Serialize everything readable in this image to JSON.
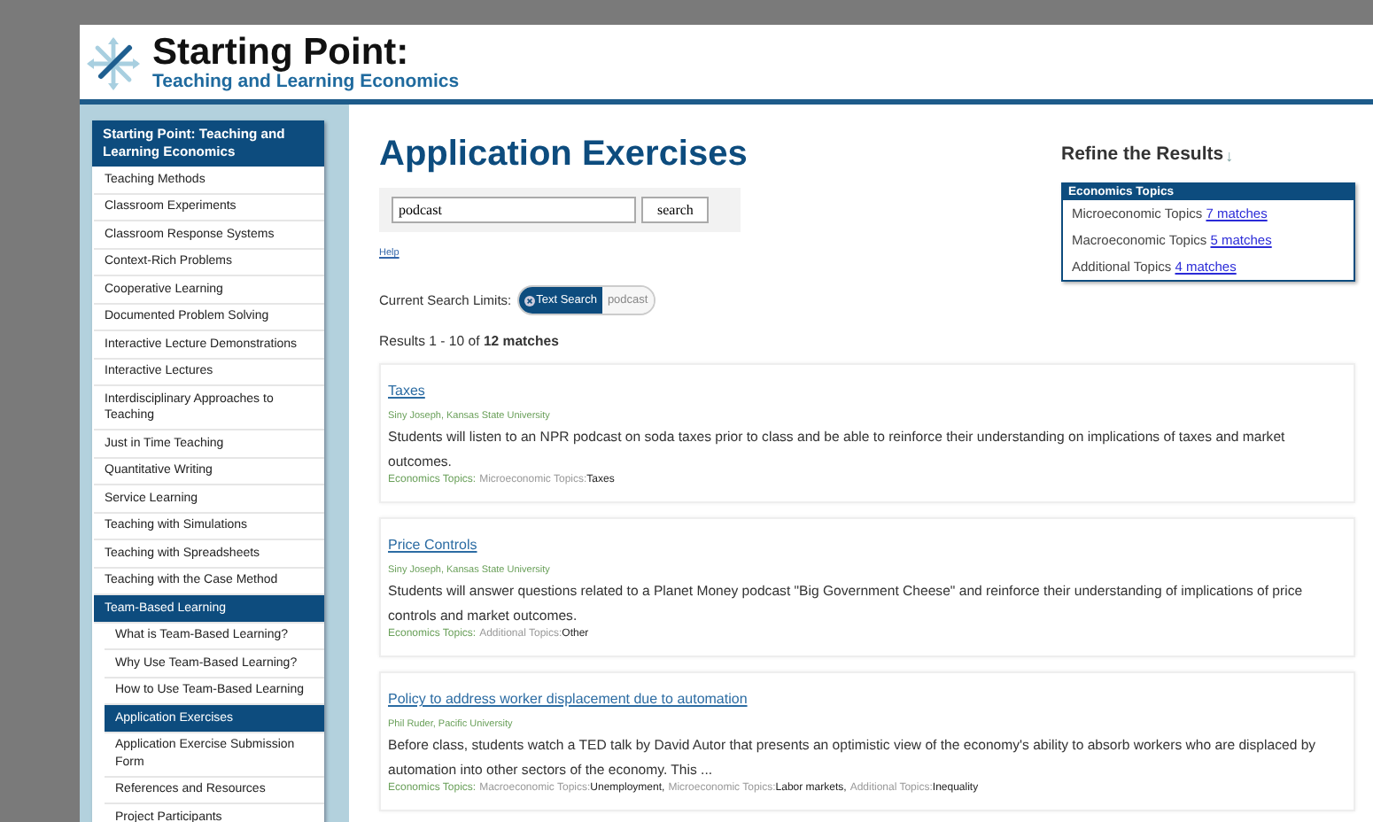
{
  "header": {
    "title": "Starting Point:",
    "subtitle": "Teaching and Learning Economics"
  },
  "sidebar": {
    "heading": "Starting Point: Teaching and Learning Economics",
    "items": [
      {
        "label": "Teaching Methods",
        "selected": false
      },
      {
        "label": "Classroom Experiments",
        "selected": false
      },
      {
        "label": "Classroom Response Systems",
        "selected": false
      },
      {
        "label": "Context-Rich Problems",
        "selected": false
      },
      {
        "label": "Cooperative Learning",
        "selected": false
      },
      {
        "label": "Documented Problem Solving",
        "selected": false
      },
      {
        "label": "Interactive Lecture Demonstrations",
        "selected": false
      },
      {
        "label": "Interactive Lectures",
        "selected": false
      },
      {
        "label": "Interdisciplinary Approaches to Teaching",
        "selected": false
      },
      {
        "label": "Just in Time Teaching",
        "selected": false
      },
      {
        "label": "Quantitative Writing",
        "selected": false
      },
      {
        "label": "Service Learning",
        "selected": false
      },
      {
        "label": "Teaching with Simulations",
        "selected": false
      },
      {
        "label": "Teaching with Spreadsheets",
        "selected": false
      },
      {
        "label": "Teaching with the Case Method",
        "selected": false
      },
      {
        "label": "Team-Based Learning",
        "selected": true,
        "children": [
          {
            "label": "What is Team-Based Learning?",
            "selected": false
          },
          {
            "label": "Why Use Team-Based Learning?",
            "selected": false
          },
          {
            "label": "How to Use Team-Based Learning",
            "selected": false
          },
          {
            "label": "Application Exercises",
            "selected": true
          },
          {
            "label": "Application Exercise Submission Form",
            "selected": false
          },
          {
            "label": "References and Resources",
            "selected": false
          },
          {
            "label": "Project Participants",
            "selected": false
          }
        ]
      }
    ]
  },
  "main": {
    "title": "Application Exercises",
    "search": {
      "value": "podcast",
      "button": "search",
      "help": "Help"
    },
    "limits": {
      "label": "Current Search Limits:",
      "chip_type": "Text Search",
      "chip_value": "podcast"
    },
    "results_summary": "Results 1 - 10 of **12 matches**",
    "refine": {
      "title": "Refine the Results",
      "arrow": "↓",
      "group": "Economics Topics",
      "facets": [
        {
          "label": "Microeconomic Topics",
          "count": "7 matches"
        },
        {
          "label": "Macroeconomic Topics",
          "count": "5 matches"
        },
        {
          "label": "Additional Topics",
          "count": "4 matches"
        }
      ]
    },
    "results": [
      {
        "title": "Taxes",
        "author": "Siny Joseph, Kansas State University",
        "description": "Students will listen to an NPR podcast on soda taxes prior to class and be able to reinforce their understanding on implications of taxes and market outcomes.",
        "topics_label": "Economics Topics:",
        "tags": [
          {
            "category": "Microeconomic Topics:",
            "value": "Taxes"
          }
        ]
      },
      {
        "title": "Price Controls",
        "author": "Siny Joseph, Kansas State University",
        "description": "Students will answer questions related to a Planet Money podcast \"Big Government Cheese\" and reinforce their understanding of implications of price controls and market outcomes.",
        "topics_label": "Economics Topics:",
        "tags": [
          {
            "category": "Additional Topics:",
            "value": "Other"
          }
        ]
      },
      {
        "title": "Policy to address worker displacement due to automation",
        "author": "Phil Ruder, Pacific University",
        "description": "Before class, students watch a TED talk by David Autor that presents an optimistic view of the economy's ability to absorb workers who are displaced by automation into other sectors of the economy. This ...",
        "topics_label": "Economics Topics:",
        "tags": [
          {
            "category": "Macroeconomic Topics:",
            "value": "Unemployment,"
          },
          {
            "category": "Microeconomic Topics:",
            "value": "Labor markets,"
          },
          {
            "category": "Additional Topics:",
            "value": "Inequality"
          }
        ]
      }
    ]
  }
}
